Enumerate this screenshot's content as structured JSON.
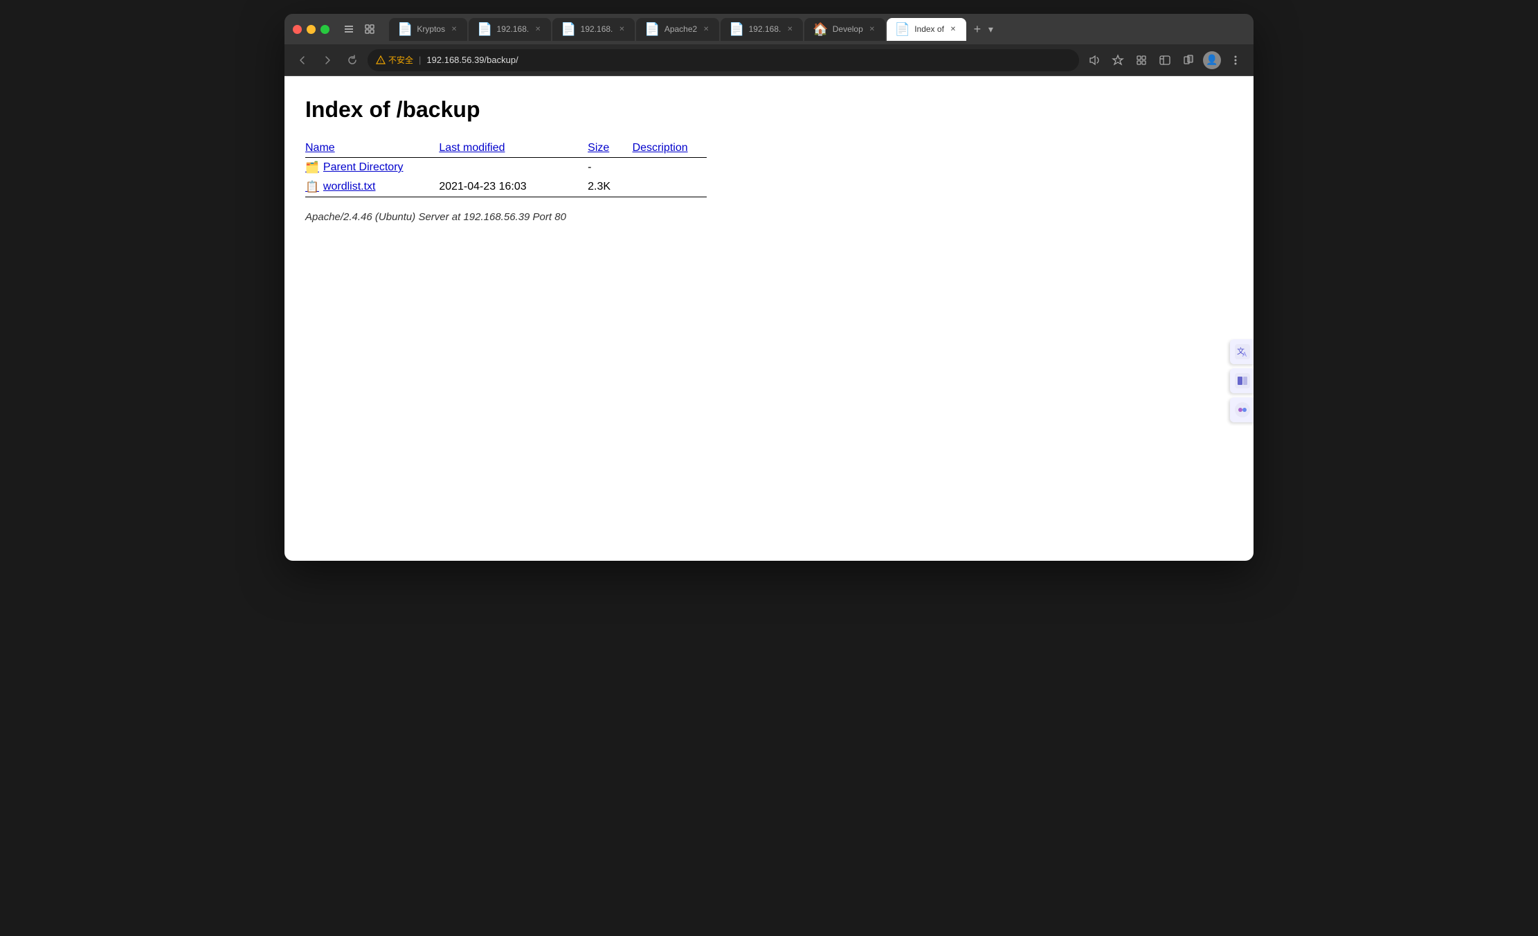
{
  "browser": {
    "tabs": [
      {
        "id": "kryptos",
        "label": "Kryptos",
        "active": false,
        "icon": "📄"
      },
      {
        "id": "192-1",
        "label": "192.168.",
        "active": false,
        "icon": "📄"
      },
      {
        "id": "192-2",
        "label": "192.168.",
        "active": false,
        "icon": "📄"
      },
      {
        "id": "apache",
        "label": "Apache2",
        "active": false,
        "icon": "📄"
      },
      {
        "id": "192-3",
        "label": "192.168.",
        "active": false,
        "icon": "📄"
      },
      {
        "id": "develop",
        "label": "Develop",
        "active": false,
        "icon": "🏠"
      },
      {
        "id": "index",
        "label": "Index of",
        "active": true,
        "icon": "📄"
      }
    ],
    "address_bar": {
      "security_label": "不安全",
      "url": "192.168.56.39/backup/"
    }
  },
  "page": {
    "title": "Index of /backup",
    "table": {
      "headers": {
        "name": "Name",
        "last_modified": "Last modified",
        "size": "Size",
        "description": "Description"
      },
      "rows": [
        {
          "name": "Parent Directory",
          "href": "../",
          "last_modified": "",
          "size": "-",
          "description": "",
          "icon": "folder-parent"
        },
        {
          "name": "wordlist.txt",
          "href": "wordlist.txt",
          "last_modified": "2021-04-23 16:03",
          "size": "2.3K",
          "description": "",
          "icon": "file-text"
        }
      ]
    },
    "server_info": "Apache/2.4.46 (Ubuntu) Server at 192.168.56.39 Port 80"
  }
}
